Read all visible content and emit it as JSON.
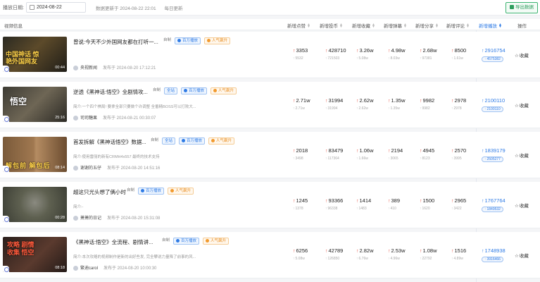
{
  "filter": {
    "date_label": "播放日期:",
    "date_value": "2024-08-22",
    "update_time": "数据更新于 2024-08-22 22:01",
    "update_freq": "每日更新",
    "export_label": "导出数据"
  },
  "columns": {
    "video_info": "视频信息",
    "likes": "新增点赞",
    "coins": "新增投币",
    "favorites": "新增收藏",
    "danmaku": "新增弹幕",
    "shares": "新增分享",
    "comments": "新增评论",
    "plays": "新增播放",
    "actions": "操作"
  },
  "common": {
    "fav_label": "收藏",
    "desc_prefix": "简介:"
  },
  "rows": [
    {
      "title": "曾说:今天不少外国网友都在打听一...",
      "tags": [
        "自制",
        "百万播放",
        "人气飙升"
      ],
      "thumb_text": "中国神话 惊艳外国网友",
      "duration": "00:44",
      "desc": "",
      "author": "央视新闻",
      "time": "发布于 2024-08-20 17:12:21",
      "likes": "3353",
      "likes_sub": "5532",
      "coins": "428710",
      "coins_sub": "721503",
      "favorites": "3.26w",
      "favorites_sub": "5.08w",
      "danmaku": "4.98w",
      "danmaku_sub": "8.03w",
      "shares": "2.68w",
      "shares_sub": "97381",
      "comments": "8500",
      "comments_sub": "1.61w",
      "plays": "2916754",
      "plays_sub": "4575382"
    },
    {
      "title": "逆透《黑神话:悟空》全剧情攻...",
      "tags": [
        "自制",
        "全站",
        "百万播放",
        "人气飙升"
      ],
      "thumb_text": "悟空",
      "duration": "25:16",
      "desc": "一个四个棋局! 要拿全部只要做个许调整 全番精BOSS可以打败大...",
      "author": "司司糖果",
      "time": "发布于 2024-08-21 00:30:07",
      "likes": "2.71w",
      "likes_sub": "2.71w",
      "coins": "31994",
      "coins_sub": "31994",
      "favorites": "2.62w",
      "favorites_sub": "2.62w",
      "danmaku": "1.35w",
      "danmaku_sub": "1.35w",
      "shares": "9982",
      "shares_sub": "9982",
      "comments": "2978",
      "comments_sub": "2978",
      "plays": "2100110",
      "plays_sub": "2100110"
    },
    {
      "title": "首发拆解《黑神话悟空》数据...",
      "tags": [
        "自制",
        "全站",
        "百万播放",
        "人气飙升"
      ],
      "thumb_text": "解包前 解包后",
      "duration": "08:14",
      "desc": "使用雷丽的新有CRMH4x557 最终的技术支持",
      "author": "谢谢的五仔",
      "time": "发布于 2024-08-20 14:51:16",
      "likes": "2018",
      "likes_sub": "3498",
      "coins": "83479",
      "coins_sub": "117364",
      "favorites": "1.06w",
      "favorites_sub": "1.66w",
      "danmaku": "2194",
      "danmaku_sub": "3065",
      "shares": "4945",
      "shares_sub": "8123",
      "comments": "2570",
      "comments_sub": "3995",
      "plays": "1839179",
      "plays_sub": "2505277"
    },
    {
      "title": "超这只光头想了俩小时",
      "tags": [
        "自制",
        "百万播放",
        "人气飙升"
      ],
      "thumb_text": "",
      "duration": "00:28",
      "desc": "-",
      "author": "萧萧的日记",
      "time": "发布于 2024-08-20 15:31:08",
      "likes": "1245",
      "likes_sub": "1378",
      "coins": "93366",
      "coins_sub": "96338",
      "favorites": "1414",
      "favorites_sub": "1483",
      "danmaku": "389",
      "danmaku_sub": "410",
      "shares": "1500",
      "shares_sub": "1620",
      "comments": "2965",
      "comments_sub": "3422",
      "plays": "1767764",
      "plays_sub": "1849532"
    },
    {
      "title": "《黑神话:悟空》全流程、剧情讲...",
      "tags": [
        "自制",
        "百万播放",
        "人气飙升"
      ],
      "thumb_text": "攻略 剧情 收集 悟空",
      "duration": "08:18",
      "desc": "本次攻略的视频制作是新的出好些发, 完全攀说力量降了前事的风...",
      "author": "繁迪carol",
      "time": "发布于 2024-08-20 10:00:30",
      "likes": "6256",
      "likes_sub": "5.08w",
      "coins": "42789",
      "coins_sub": "126850",
      "favorites": "2.82w",
      "favorites_sub": "6.76w",
      "danmaku": "2.53w",
      "danmaku_sub": "4.96w",
      "shares": "1.08w",
      "shares_sub": "22792",
      "comments": "1516",
      "comments_sub": "4.89w",
      "plays": "1748938",
      "plays_sub": "3916466"
    }
  ],
  "colors": {
    "accent": "#2f7be5",
    "up_arrow": "#e74c3c",
    "tag_orange": "#e88a1a",
    "export_green": "#2e9e5e"
  },
  "icons": {
    "sort": "sort-caret-icon",
    "star": "star-icon",
    "calendar": "calendar-icon",
    "excel": "excel-icon"
  }
}
